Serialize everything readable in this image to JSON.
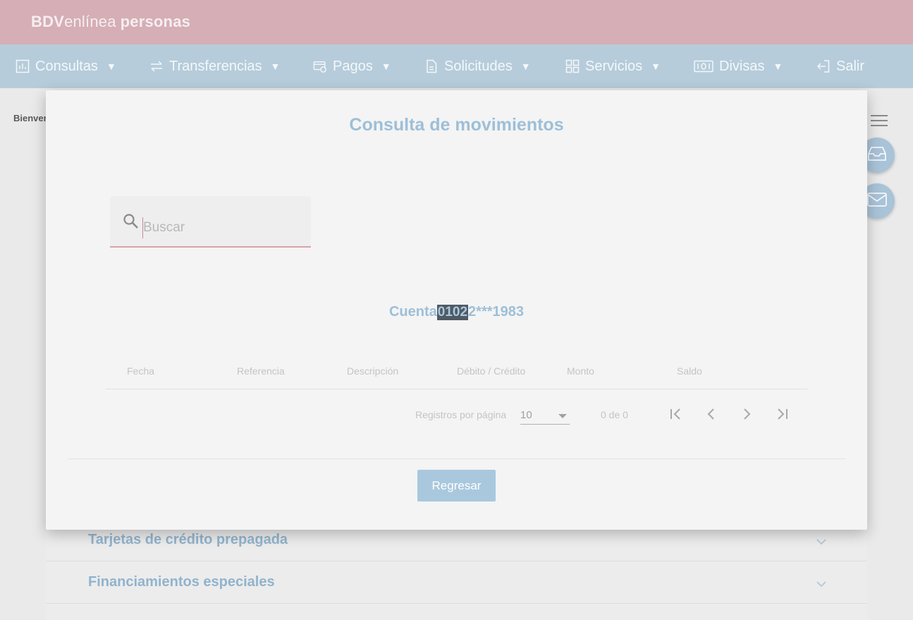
{
  "brand": {
    "part1": "BDV",
    "part2": "enlínea",
    "part3": "personas"
  },
  "nav": {
    "consultas": "Consultas",
    "transferencias": "Transferencias",
    "pagos": "Pagos",
    "solicitudes": "Solicitudes",
    "servicios": "Servicios",
    "divisas": "Divisas",
    "salir": "Salir"
  },
  "welcome": "Bienver",
  "accordion": {
    "items": [
      {
        "label": "Tarjetas de crédito prepagada"
      },
      {
        "label": "Financiamientos especiales"
      }
    ]
  },
  "modal": {
    "title": "Consulta de movimientos",
    "search": {
      "placeholder": "Buscar",
      "value": ""
    },
    "account": {
      "prefix": "Cuenta",
      "masked": "0102",
      "suffix": "2***1983"
    },
    "table": {
      "headers": [
        "Fecha",
        "Referencia",
        "Descripción",
        "Débito / Crédito",
        "Monto",
        "Saldo"
      ]
    },
    "pager": {
      "rows_per_page_label": "Registros por página",
      "rows_per_page_value": "10",
      "range": "0 de 0"
    },
    "back_button": "Regresar"
  },
  "colors": {
    "topbar": "#d5aeb6",
    "navbar": "#b6ccda",
    "accent_blue": "#9dbfd8",
    "accent_pink": "#d7a3ad"
  }
}
